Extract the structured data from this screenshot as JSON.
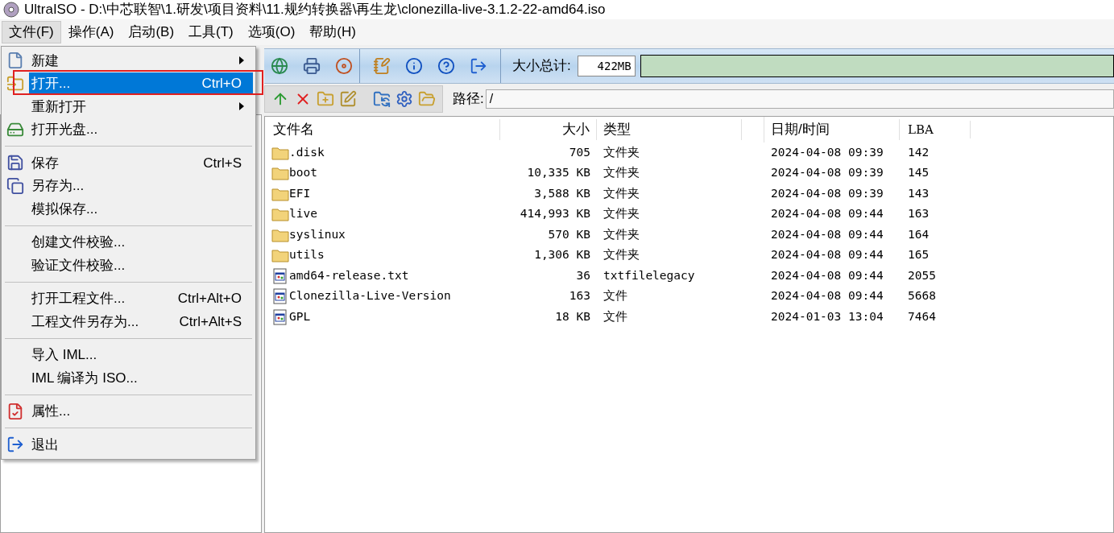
{
  "window": {
    "title": "UltraISO - D:\\中芯联智\\1.研发\\项目资料\\11.规约转换器\\再生龙\\clonezilla-live-3.1.2-22-amd64.iso"
  },
  "menu_bar": [
    {
      "label": "文件(F)",
      "selected": true
    },
    {
      "label": "操作(A)",
      "selected": false
    },
    {
      "label": "启动(B)",
      "selected": false
    },
    {
      "label": "工具(T)",
      "selected": false
    },
    {
      "label": "选项(O)",
      "selected": false
    },
    {
      "label": "帮助(H)",
      "selected": false
    }
  ],
  "file_menu": {
    "items": [
      {
        "kind": "item",
        "label": "新建",
        "submenu": true,
        "selected": false
      },
      {
        "kind": "item",
        "label": "打开...",
        "shortcut": "Ctrl+O",
        "submenu": false,
        "selected": true
      },
      {
        "kind": "item",
        "label": "重新打开",
        "submenu": true,
        "selected": false
      },
      {
        "kind": "item",
        "label": "打开光盘...",
        "submenu": false,
        "selected": false
      },
      {
        "kind": "separator"
      },
      {
        "kind": "item",
        "label": "保存",
        "shortcut": "Ctrl+S",
        "submenu": false,
        "selected": false
      },
      {
        "kind": "item",
        "label": "另存为...",
        "submenu": false,
        "selected": false
      },
      {
        "kind": "item",
        "label": "模拟保存...",
        "submenu": false,
        "selected": false
      },
      {
        "kind": "separator"
      },
      {
        "kind": "item",
        "label": "创建文件校验...",
        "submenu": false,
        "selected": false
      },
      {
        "kind": "item",
        "label": "验证文件校验...",
        "submenu": false,
        "selected": false
      },
      {
        "kind": "separator"
      },
      {
        "kind": "item",
        "label": "打开工程文件...",
        "shortcut": "Ctrl+Alt+O",
        "submenu": false,
        "selected": false
      },
      {
        "kind": "item",
        "label": "工程文件另存为...",
        "shortcut": "Ctrl+Alt+S",
        "submenu": false,
        "selected": false
      },
      {
        "kind": "separator"
      },
      {
        "kind": "item",
        "label": "导入 IML...",
        "submenu": false,
        "selected": false
      },
      {
        "kind": "item",
        "label": "IML 编译为 ISO...",
        "submenu": false,
        "selected": false
      },
      {
        "kind": "separator"
      },
      {
        "kind": "item",
        "label": "属性...",
        "submenu": false,
        "selected": false
      },
      {
        "kind": "separator"
      },
      {
        "kind": "item",
        "label": "退出",
        "submenu": false,
        "selected": false
      }
    ]
  },
  "toolbar": {
    "size_label": "大小总计:",
    "size_value": "422MB",
    "capacity": {
      "level": 1
    }
  },
  "path_bar": {
    "label": "路径:",
    "value": "/"
  },
  "table": {
    "columns": [
      "文件名",
      "大小",
      "类型",
      "日期/时间",
      "LBA"
    ],
    "rows": [
      {
        "kind": "folder",
        "name": ".disk",
        "size": "705",
        "type": "文件夹",
        "date": "2024-04-08 09:39",
        "lba": "142"
      },
      {
        "kind": "folder",
        "name": "boot",
        "size": "10,335 KB",
        "type": "文件夹",
        "date": "2024-04-08 09:39",
        "lba": "145"
      },
      {
        "kind": "folder",
        "name": "EFI",
        "size": "3,588 KB",
        "type": "文件夹",
        "date": "2024-04-08 09:39",
        "lba": "143"
      },
      {
        "kind": "folder",
        "name": "live",
        "size": "414,993 KB",
        "type": "文件夹",
        "date": "2024-04-08 09:44",
        "lba": "163"
      },
      {
        "kind": "folder",
        "name": "syslinux",
        "size": "570 KB",
        "type": "文件夹",
        "date": "2024-04-08 09:44",
        "lba": "164"
      },
      {
        "kind": "folder",
        "name": "utils",
        "size": "1,306 KB",
        "type": "文件夹",
        "date": "2024-04-08 09:44",
        "lba": "165"
      },
      {
        "kind": "file",
        "name": "amd64-release.txt",
        "size": "36",
        "type": "txtfilelegacy",
        "date": "2024-04-08 09:44",
        "lba": "2055"
      },
      {
        "kind": "file",
        "name": "Clonezilla-Live-Version",
        "size": "163",
        "type": "文件",
        "date": "2024-04-08 09:44",
        "lba": "5668"
      },
      {
        "kind": "file",
        "name": "GPL",
        "size": "18 KB",
        "type": "文件",
        "date": "2024-01-03 13:04",
        "lba": "7464"
      }
    ]
  }
}
